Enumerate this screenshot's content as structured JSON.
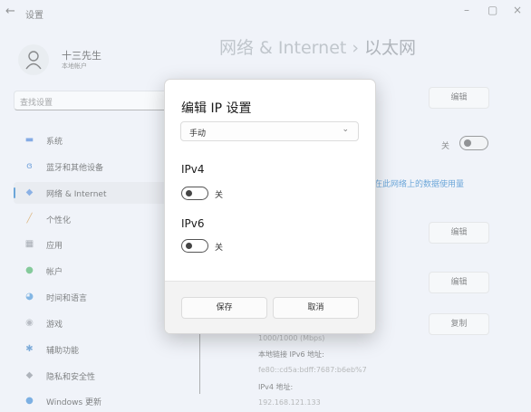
{
  "window": {
    "title": "设置",
    "back_icon": "←",
    "minimize_icon": "–",
    "maximize_icon": "▢",
    "close_icon": "×"
  },
  "user": {
    "name": "十三先生",
    "account": "本地帐户"
  },
  "search": {
    "placeholder": "查找设置"
  },
  "sidebar": {
    "items": [
      {
        "label": "系统",
        "icon": "▬",
        "color": "#2f6fd6"
      },
      {
        "label": "蓝牙和其他设备",
        "icon": "ɞ",
        "color": "#1566c8"
      },
      {
        "label": "网络 & Internet",
        "icon": "◆",
        "color": "#3a7bd5",
        "selected": true
      },
      {
        "label": "个性化",
        "icon": "╱",
        "color": "#d08a2c"
      },
      {
        "label": "应用",
        "icon": "▦",
        "color": "#6a6f7a"
      },
      {
        "label": "帐户",
        "icon": "●",
        "color": "#2ea84f"
      },
      {
        "label": "时间和语言",
        "icon": "◕",
        "color": "#2b84d4"
      },
      {
        "label": "游戏",
        "icon": "◉",
        "color": "#8a8f99"
      },
      {
        "label": "辅助功能",
        "icon": "✱",
        "color": "#1f6fc0"
      },
      {
        "label": "隐私和安全性",
        "icon": "◆",
        "color": "#7b808a"
      },
      {
        "label": "Windows 更新",
        "icon": "●",
        "color": "#1e78d2"
      }
    ]
  },
  "header": {
    "crumb1": "网络 & Internet",
    "separator": "›",
    "crumb2": "以太网"
  },
  "background": {
    "edit_label": "编辑",
    "copy_label": "复制",
    "toggle_label": "关",
    "link_text": "在此网络上的数据使用量",
    "info": [
      {
        "text": "1000/1000 (Mbps)",
        "kind": "val"
      },
      {
        "text": "本地链接 IPv6 地址:",
        "kind": "lab"
      },
      {
        "text": "fe80::cd5a:bdff:7687:b6eb%7",
        "kind": "val"
      },
      {
        "text": "IPv4 地址:",
        "kind": "lab"
      },
      {
        "text": "192.168.121.133",
        "kind": "val"
      }
    ]
  },
  "dialog": {
    "title": "编辑 IP 设置",
    "mode_value": "手动",
    "dropdown_icon": "⌄",
    "ipv4": {
      "label": "IPv4",
      "toggle_label": "关"
    },
    "ipv6": {
      "label": "IPv6",
      "toggle_label": "关"
    },
    "save_label": "保存",
    "cancel_label": "取消"
  }
}
